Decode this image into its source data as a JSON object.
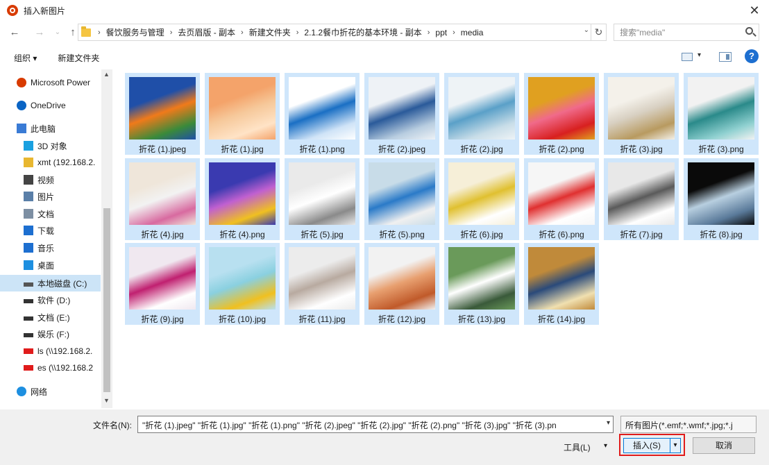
{
  "window": {
    "title": "插入新图片",
    "close_glyph": "✕"
  },
  "nav": {
    "back": "←",
    "forward": "→",
    "up": "↑"
  },
  "breadcrumb": {
    "items": [
      "餐饮服务与管理",
      "去页眉版 - 副本",
      "新建文件夹",
      "2.1.2餐巾折花的基本环境 - 副本",
      "ppt",
      "media"
    ],
    "separator": "›",
    "dropdown": "⌄",
    "refresh": "↻"
  },
  "search": {
    "placeholder": "搜索\"media\""
  },
  "toolbar": {
    "organize_label": "组织 ▾",
    "new_folder_label": "新建文件夹",
    "view_drop": "▾",
    "help": "?"
  },
  "sidebar": {
    "items": [
      {
        "label": "Microsoft Power",
        "icon": "powerpoint-icon",
        "color": "#d83b01",
        "selected": false
      },
      {
        "label": "OneDrive",
        "icon": "cloud-icon",
        "color": "#0a64c4",
        "selected": false
      },
      {
        "label": "此电脑",
        "icon": "computer-icon",
        "color": "#3a7bd5",
        "selected": false
      },
      {
        "label": "3D 对象",
        "icon": "cube-icon",
        "color": "#1aa0e0",
        "selected": false
      },
      {
        "label": "xmt (192.168.2.",
        "icon": "user-folder-icon",
        "color": "#e8b730",
        "selected": false
      },
      {
        "label": "视频",
        "icon": "video-icon",
        "color": "#444444",
        "selected": false
      },
      {
        "label": "图片",
        "icon": "picture-icon",
        "color": "#5a7fa8",
        "selected": false
      },
      {
        "label": "文档",
        "icon": "document-icon",
        "color": "#7d8fa3",
        "selected": false
      },
      {
        "label": "下载",
        "icon": "download-icon",
        "color": "#1d6fd0",
        "selected": false
      },
      {
        "label": "音乐",
        "icon": "music-icon",
        "color": "#1d6fd0",
        "selected": false
      },
      {
        "label": "桌面",
        "icon": "desktop-icon",
        "color": "#1d8fe0",
        "selected": false
      },
      {
        "label": "本地磁盘 (C:)",
        "icon": "drive-icon",
        "color": "#555555",
        "selected": true
      },
      {
        "label": "软件 (D:)",
        "icon": "drive-icon",
        "color": "#333333",
        "selected": false
      },
      {
        "label": "文档 (E:)",
        "icon": "drive-icon",
        "color": "#333333",
        "selected": false
      },
      {
        "label": "娱乐 (F:)",
        "icon": "drive-icon",
        "color": "#333333",
        "selected": false
      },
      {
        "label": "ls (\\\\192.168.2.",
        "icon": "network-drive-disconnected-icon",
        "color": "#e01b1b",
        "selected": false
      },
      {
        "label": "es (\\\\192.168.2",
        "icon": "network-drive-disconnected-icon",
        "color": "#e01b1b",
        "selected": false
      },
      {
        "label": "网络",
        "icon": "network-icon",
        "color": "#1d8fe0",
        "selected": false
      }
    ],
    "scroll_up": "▲",
    "scroll_down": "▼"
  },
  "files": [
    {
      "name": "折花 (1).jpeg",
      "palette": [
        "#1f4fa8",
        "#f07a1a",
        "#3a8a3a"
      ]
    },
    {
      "name": "折花 (1).jpg",
      "palette": [
        "#f4a36a",
        "#f6c89a",
        "#ffe3c6"
      ]
    },
    {
      "name": "折花 (1).png",
      "palette": [
        "#ffffff",
        "#1a6fc4",
        "#cfe3f7"
      ]
    },
    {
      "name": "折花 (2).jpeg",
      "palette": [
        "#eef2f6",
        "#2a5a9a",
        "#b8cde0"
      ]
    },
    {
      "name": "折花 (2).jpg",
      "palette": [
        "#eef3f6",
        "#5aa0c8",
        "#c8dde8"
      ]
    },
    {
      "name": "折花 (2).png",
      "palette": [
        "#e0a020",
        "#f06a8a",
        "#d82020"
      ]
    },
    {
      "name": "折花 (3).jpg",
      "palette": [
        "#f4f1ea",
        "#d8d0c2",
        "#b89a60"
      ]
    },
    {
      "name": "折花 (3).png",
      "palette": [
        "#f2f2f2",
        "#2a8a8a",
        "#8fd0d0"
      ]
    },
    {
      "name": "折花 (4).jpg",
      "palette": [
        "#efe6da",
        "#f2f2f2",
        "#d86aa0"
      ]
    },
    {
      "name": "折花 (4).png",
      "palette": [
        "#3a3ab0",
        "#c060d0",
        "#f0c020"
      ]
    },
    {
      "name": "折花 (5).jpg",
      "palette": [
        "#eaeaea",
        "#ffffff",
        "#8a8a8a"
      ]
    },
    {
      "name": "折花 (5).png",
      "palette": [
        "#c8dce8",
        "#2a7ac8",
        "#f0f0f0"
      ]
    },
    {
      "name": "折花 (6).jpg",
      "palette": [
        "#f6efd8",
        "#e0c030",
        "#ffffff"
      ]
    },
    {
      "name": "折花 (6).png",
      "palette": [
        "#f6f6f6",
        "#e03030",
        "#ffffff"
      ]
    },
    {
      "name": "折花 (7).jpg",
      "palette": [
        "#e8e8e8",
        "#5a5a5a",
        "#ffffff"
      ]
    },
    {
      "name": "折花 (8).jpg",
      "palette": [
        "#0a0a0a",
        "#b8cfe0",
        "#5a7a9a"
      ]
    },
    {
      "name": "折花 (9).jpg",
      "palette": [
        "#f0e8f0",
        "#c02070",
        "#ffffff"
      ]
    },
    {
      "name": "折花 (10).jpg",
      "palette": [
        "#b8e0f0",
        "#8ad0e0",
        "#f0c020"
      ]
    },
    {
      "name": "折花 (11).jpg",
      "palette": [
        "#ececec",
        "#b8aaa0",
        "#ffffff"
      ]
    },
    {
      "name": "折花 (12).jpg",
      "palette": [
        "#f2f2f2",
        "#e8a070",
        "#c05a2a"
      ]
    },
    {
      "name": "折花 (13).jpg",
      "palette": [
        "#6a9a5a",
        "#ffffff",
        "#3a5a3a"
      ]
    },
    {
      "name": "折花 (14).jpg",
      "palette": [
        "#c08a3a",
        "#2a4a7a",
        "#f0e0b0"
      ]
    }
  ],
  "footer": {
    "filename_label": "文件名(N):",
    "filename_value": "\"折花 (1).jpeg\" \"折花 (1).jpg\" \"折花 (1).png\" \"折花 (2).jpeg\" \"折花 (2).jpg\" \"折花 (2).png\" \"折花 (3).jpg\" \"折花 (3).pn",
    "filter_value": "所有图片(*.emf;*.wmf;*.jpg;*.j",
    "tools_label": "工具(L)",
    "open_label": "插入(S)",
    "cancel_label": "取消",
    "dropdown_glyph": "▾"
  }
}
